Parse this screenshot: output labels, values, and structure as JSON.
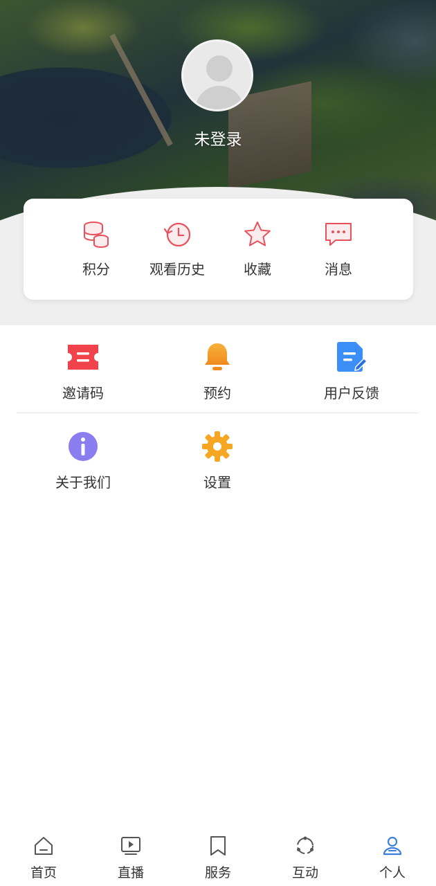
{
  "header": {
    "login_text": "未登录"
  },
  "quick_actions": [
    {
      "label": "积分",
      "icon": "coins-icon"
    },
    {
      "label": "观看历史",
      "icon": "history-icon"
    },
    {
      "label": "收藏",
      "icon": "star-icon"
    },
    {
      "label": "消息",
      "icon": "message-icon"
    }
  ],
  "menu": [
    {
      "label": "邀请码",
      "icon": "ticket-icon",
      "color": "#f0434c"
    },
    {
      "label": "预约",
      "icon": "bell-icon",
      "color": "#f5a623"
    },
    {
      "label": "用户反馈",
      "icon": "feedback-icon",
      "color": "#3a8ef6"
    },
    {
      "label": "关于我们",
      "icon": "info-icon",
      "color": "#8a7df0"
    },
    {
      "label": "设置",
      "icon": "gear-icon",
      "color": "#f5a623"
    }
  ],
  "tabbar": [
    {
      "label": "首页",
      "icon": "home-icon"
    },
    {
      "label": "直播",
      "icon": "play-icon"
    },
    {
      "label": "服务",
      "icon": "bookmark-icon"
    },
    {
      "label": "互动",
      "icon": "interaction-icon"
    },
    {
      "label": "个人",
      "icon": "person-icon",
      "active": true
    }
  ],
  "colors": {
    "accent_red": "#e8505b",
    "active_tab": "#3a7fd5",
    "inactive_tab": "#555555"
  }
}
